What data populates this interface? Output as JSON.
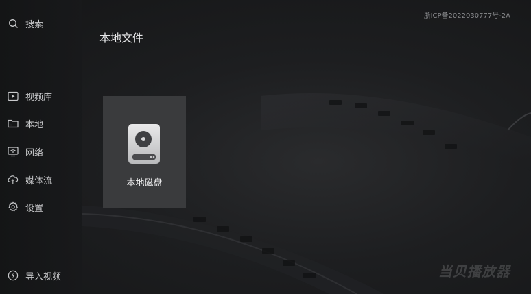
{
  "sidebar": {
    "search": {
      "label": "搜索",
      "icon": "search-icon"
    },
    "items": [
      {
        "label": "视频库",
        "icon": "video-library-icon"
      },
      {
        "label": "本地",
        "icon": "folder-icon"
      },
      {
        "label": "网络",
        "icon": "network-icon"
      },
      {
        "label": "媒体流",
        "icon": "cloud-icon"
      },
      {
        "label": "设置",
        "icon": "gear-icon"
      }
    ],
    "import": {
      "label": "导入视频",
      "icon": "import-icon"
    }
  },
  "header": {
    "title": "本地文件",
    "icp": "浙ICP备2022030777号-2A"
  },
  "main": {
    "tiles": [
      {
        "label": "本地磁盘",
        "icon": "hard-disk-icon"
      }
    ]
  },
  "watermark": "当贝播放器",
  "colors": {
    "background": "#1d1e20",
    "sidebar": "#161718",
    "tile": "#3a3b3d",
    "text": "#c9cacc"
  }
}
